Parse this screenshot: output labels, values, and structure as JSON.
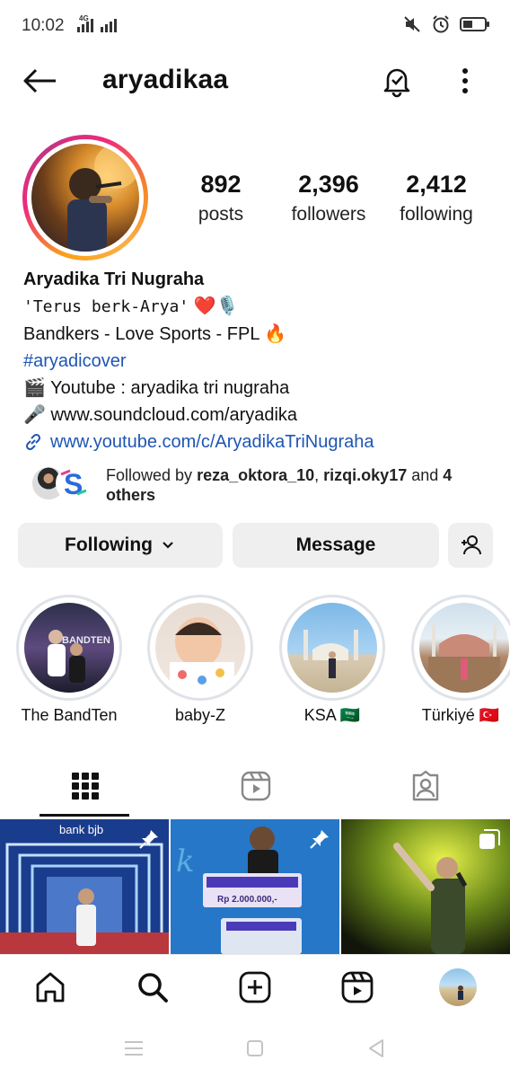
{
  "status_bar": {
    "time": "10:02",
    "network_label": "4G",
    "icons": [
      "signal-icon",
      "signal-icon",
      "mute-icon",
      "alarm-icon",
      "battery-icon"
    ]
  },
  "header": {
    "username": "aryadikaa",
    "icons": [
      "back-arrow-icon",
      "notification-bell-icon",
      "more-options-icon"
    ]
  },
  "profile": {
    "stats": [
      {
        "value": "892",
        "label": "posts"
      },
      {
        "value": "2,396",
        "label": "followers"
      },
      {
        "value": "2,412",
        "label": "following"
      }
    ],
    "name": "Aryadika Tri Nugraha",
    "bio_line1": "'Terus berk-Arya'",
    "bio_line1_emoji": "❤️🎙️",
    "bio_line2": "Bandkers - Love Sports - FPL 🔥",
    "hashtag": "#aryadicover",
    "youtube_line": "🎬 Youtube : aryadika tri nugraha",
    "soundcloud_line": "🎤 www.soundcloud.com/aryadika",
    "link": "www.youtube.com/c/AryadikaTriNugraha",
    "followed_by_prefix": "Followed by ",
    "followed_by_user1": "reza_oktora_10",
    "followed_by_sep": ", ",
    "followed_by_user2": "rizqi.oky17",
    "followed_by_and": " and ",
    "followed_by_others": "4 others"
  },
  "buttons": {
    "following": "Following",
    "message": "Message"
  },
  "highlights": [
    {
      "label": "The BandTen"
    },
    {
      "label": "baby-Z"
    },
    {
      "label": "KSA 🇸🇦"
    },
    {
      "label": "Türkiyé 🇹🇷"
    }
  ],
  "highlight_texts": {
    "bandten_sign": "BANDTEN"
  },
  "tabs": [
    "grid-icon",
    "reels-icon",
    "tagged-icon"
  ],
  "posts": [
    {
      "overlay_text": "bank bjb",
      "icon": "pin-icon"
    },
    {
      "overlay_text": "Rp 2.000.000,-",
      "icon": "pin-icon"
    },
    {
      "overlay_text": "",
      "icon": "multiple-posts-icon"
    }
  ],
  "bottom_nav": [
    "home-icon",
    "search-icon",
    "create-icon",
    "reels-icon",
    "profile-avatar"
  ],
  "colors": {
    "link_blue": "#1f56b3",
    "button_bg": "#efefef",
    "story_ring_start": "#f9a11b",
    "story_ring_end": "#c13584"
  }
}
